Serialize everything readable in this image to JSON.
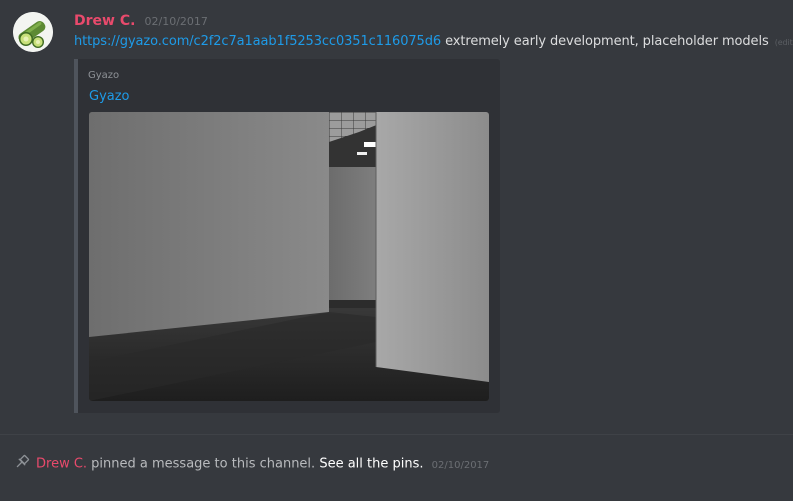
{
  "message": {
    "avatar_icon": "cucumber-avatar-icon",
    "username": "Drew C.",
    "timestamp": "02/10/2017",
    "link": "https://gyazo.com/c2f2c7a1aab1f5253cc0351c116075d6",
    "text": " extremely early development, placeholder models",
    "edited": "(edited)",
    "embed": {
      "provider": "Gyazo",
      "title": "Gyazo",
      "image": "3d-corridor-screenshot"
    }
  },
  "system_message": {
    "icon": "pin-icon",
    "username": "Drew C.",
    "text": " pinned a message to this channel. ",
    "link": "See all the pins.",
    "timestamp": "02/10/2017"
  },
  "colors": {
    "background": "#36393e",
    "username": "#e94a6c",
    "link": "#1e9be8",
    "embed_background": "#2f3136"
  }
}
